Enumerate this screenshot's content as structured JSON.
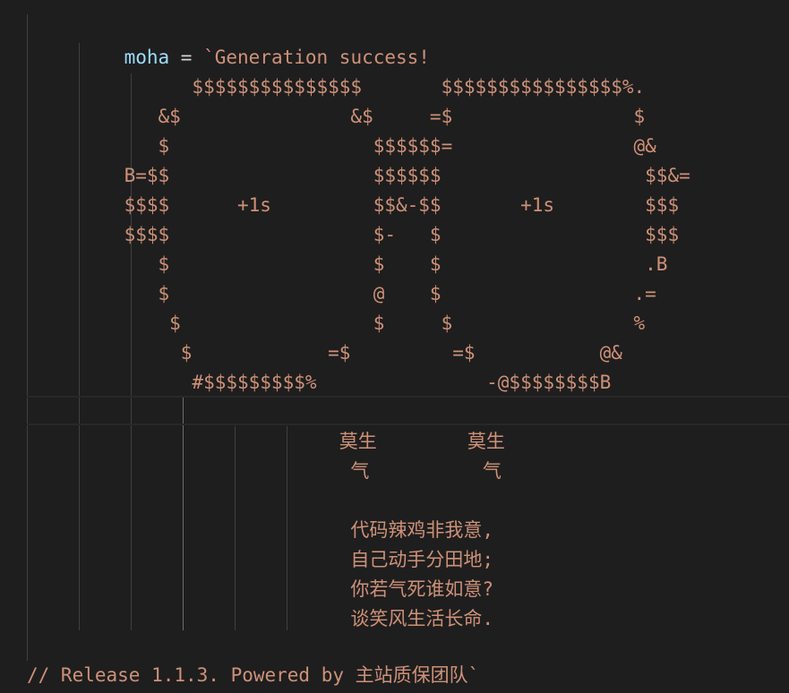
{
  "code": {
    "variable": "moha",
    "operator": " = ",
    "string_open": "`Generation success!",
    "art_lines": [
      "          $$$$$$$$$$$$$$$       $$$$$$$$$$$$$$$$%.",
      "       &$               &$     =$                $",
      "       $                  $$$$$$=                @&",
      "    B=$$                  $$$$$$                  $$&=",
      "    $$$$      +1s         $$&-$$       +1s        $$$",
      "    $$$$                  $-   $                  $$$",
      "       $                  $    $                  .B",
      "       $                  @    $                 .=",
      "        $                 $     $                %",
      "         $            =$         =$           @&",
      "          #$$$$$$$$$%               -@$$$$$$$$B"
    ],
    "empty_line": "",
    "poem_lines": [
      "                       莫生        莫生",
      "                        气          气",
      "",
      "                        代码辣鸡非我意,",
      "                        自己动手分田地;",
      "                        你若气死谁如意?",
      "                        谈笑风生活长命.",
      ""
    ],
    "closing": "// Release 1.1.3. Powered by 主站质保团队`"
  }
}
